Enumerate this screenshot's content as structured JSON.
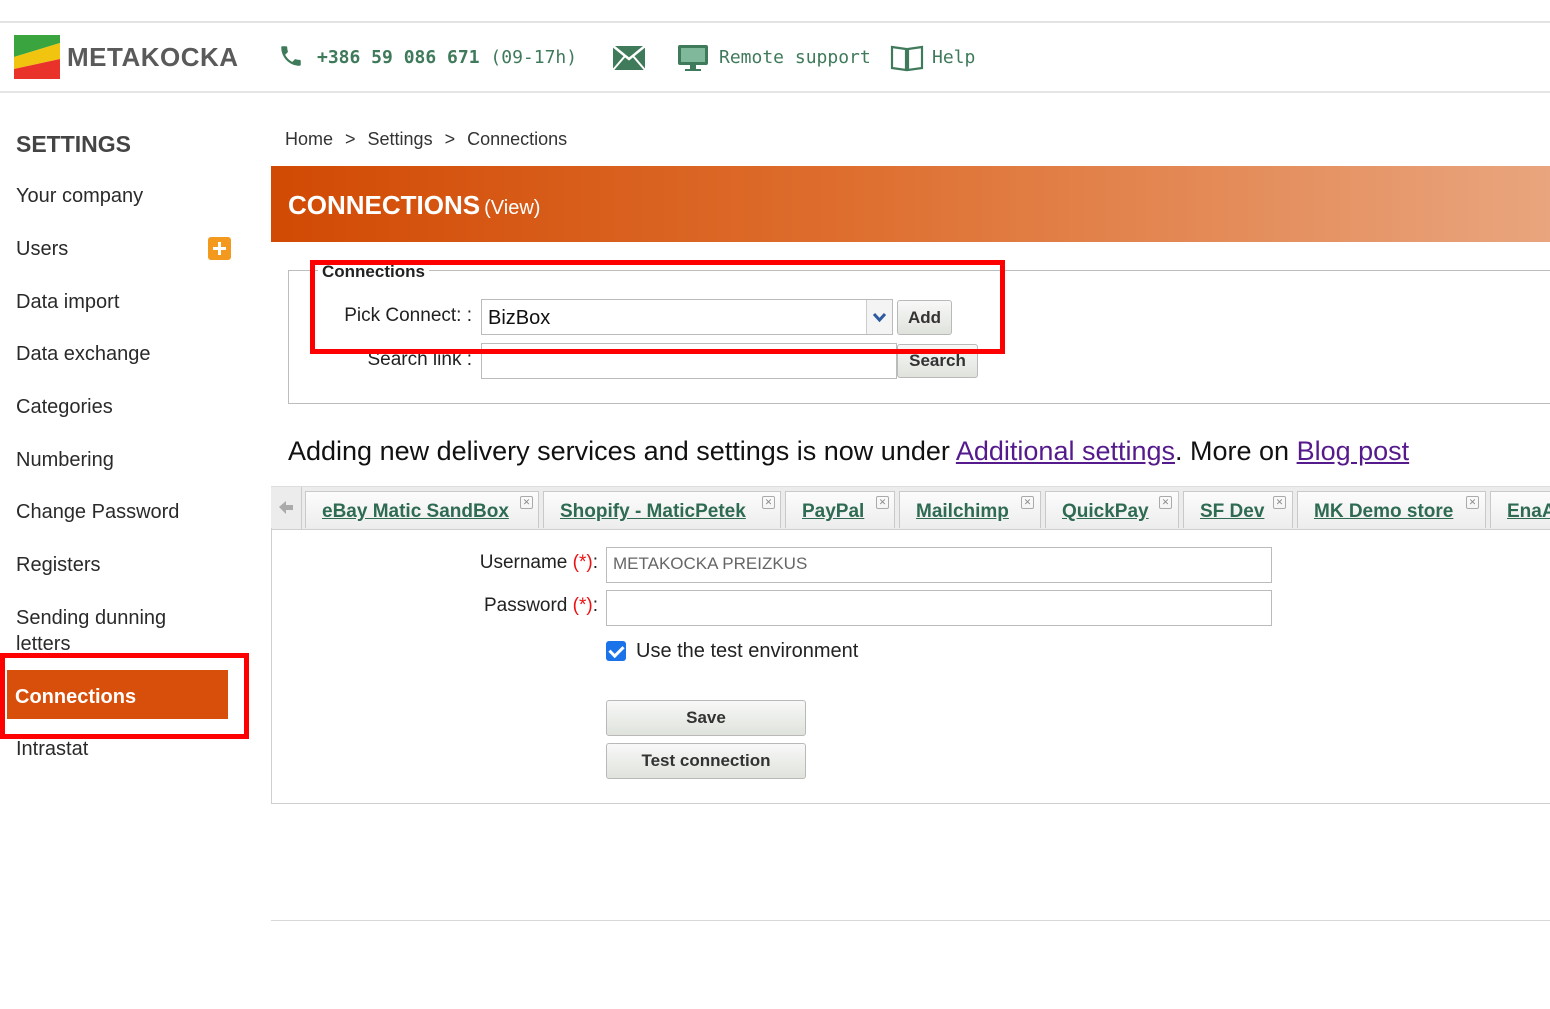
{
  "colors": {
    "accent": "#d84f0c",
    "link_green": "#3f7a5a",
    "annotation_red": "#ff0000"
  },
  "header": {
    "brand": "METAKOCKA",
    "phone": "+386 59 086 671",
    "phone_hours": "(09-17h)",
    "remote_support": "Remote support",
    "help": "Help",
    "icons": [
      "logo",
      "phone-icon",
      "mail-icon",
      "monitor-icon",
      "book-icon"
    ]
  },
  "sidebar": {
    "title": "SETTINGS",
    "items": [
      {
        "label": "Your company"
      },
      {
        "label": "Users"
      },
      {
        "label": "Data import"
      },
      {
        "label": "Data exchange"
      },
      {
        "label": "Categories"
      },
      {
        "label": "Numbering"
      },
      {
        "label": "Change Password"
      },
      {
        "label": "Registers"
      },
      {
        "label": "Sending dunning letters"
      },
      {
        "label": "Connections",
        "active": true
      },
      {
        "label": "Intrastat"
      }
    ]
  },
  "breadcrumb": {
    "items": [
      "Home",
      "Settings",
      "Connections"
    ],
    "separator": ">"
  },
  "banner": {
    "title": "CONNECTIONS",
    "subtitle": "(View)"
  },
  "connections_form": {
    "legend": "Connections",
    "pick_label": "Pick Connect: :",
    "pick_value": "BizBox",
    "add_button": "Add",
    "search_label": "Search link :",
    "search_value": "",
    "search_button": "Search"
  },
  "notice": {
    "text_before": "Adding new delivery services and settings is now under ",
    "link1": "Additional settings",
    "text_middle": ". More on ",
    "link2": "Blog post"
  },
  "tabs": [
    {
      "label": "eBay Matic SandBox"
    },
    {
      "label": "Shopify - MaticPetek"
    },
    {
      "label": "PayPal"
    },
    {
      "label": "Mailchimp"
    },
    {
      "label": "QuickPay"
    },
    {
      "label": "SF Dev"
    },
    {
      "label": "MK Demo store"
    },
    {
      "label": "EnaA"
    }
  ],
  "panel": {
    "username_label": "Username",
    "username_value": "METAKOCKA PREIZKUS",
    "password_label": "Password",
    "password_value": "",
    "required_mark": "(*)",
    "test_env_label": "Use the test environment",
    "test_env_checked": true,
    "save_button": "Save",
    "test_button": "Test connection"
  }
}
